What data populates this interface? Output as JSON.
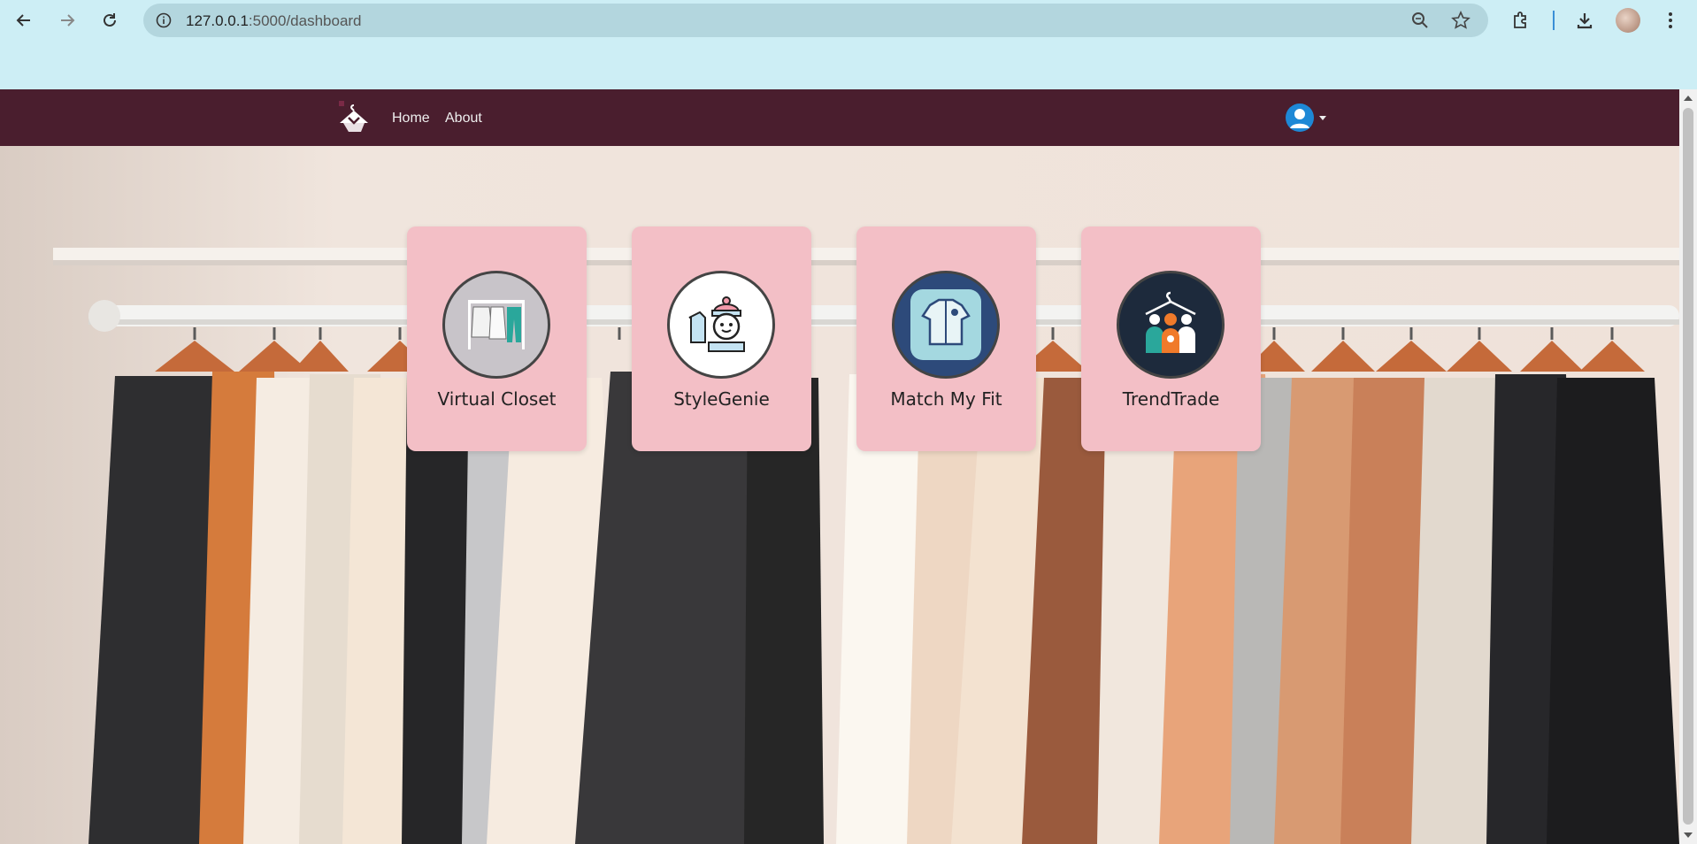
{
  "browser": {
    "url_host": "127.0.0.1",
    "url_path": ":5000/dashboard",
    "icons": [
      "back-arrow-icon",
      "forward-arrow-icon",
      "reload-icon",
      "info-icon",
      "zoom-icon",
      "star-icon",
      "extensions-icon",
      "download-icon",
      "profile-avatar",
      "kebab-menu-icon"
    ]
  },
  "navbar": {
    "brand_icon": "hanger-logo-icon",
    "links": [
      "Home",
      "About"
    ],
    "user_icon": "user-circle-icon",
    "bg_color": "#4a1e2e"
  },
  "cards": [
    {
      "label": "Virtual Closet",
      "icon": "clothes-rack-icon"
    },
    {
      "label": "StyleGenie",
      "icon": "genie-avatar-icon"
    },
    {
      "label": "Match My Fit",
      "icon": "shirt-icon"
    },
    {
      "label": "TrendTrade",
      "icon": "community-hanger-icon"
    }
  ],
  "colors": {
    "card_bg": "#f3bfc6",
    "chrome_bg": "#cdeef5",
    "accent": "#1e88d6"
  }
}
